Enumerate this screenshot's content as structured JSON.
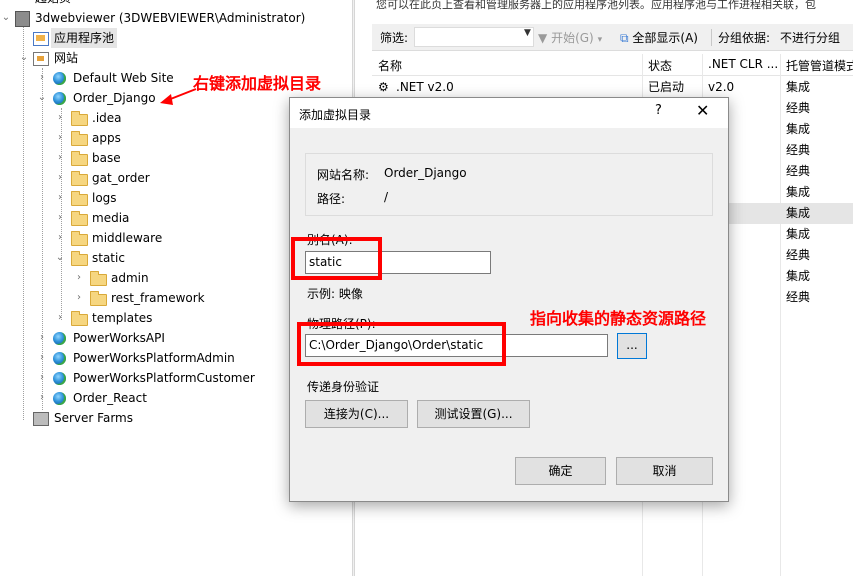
{
  "tree": {
    "top_partial": "起始页",
    "server": "3dwebviewer (3DWEBVIEWER\\Administrator)",
    "app_pools": "应用程序池",
    "sites": "网站",
    "default_site": "Default Web Site",
    "order_django": "Order_Django",
    "folders": [
      ".idea",
      "apps",
      "base",
      "gat_order",
      "logs",
      "media",
      "middleware",
      "static"
    ],
    "static_children": [
      "admin",
      "rest_framework"
    ],
    "templates": "templates",
    "other_sites": [
      "PowerWorksAPI",
      "PowerWorksPlatformAdmin",
      "PowerWorksPlatformCustomer",
      "Order_React"
    ],
    "server_farms": "Server Farms"
  },
  "right": {
    "description": "您可以在此页上查看和管理服务器上的应用程序池列表。应用程序池与工作进程相关联，包",
    "filter_label": "筛选:",
    "start_label": "开始(G)",
    "show_all_label": "全部显示(A)",
    "group_by_label": "分组依据:",
    "group_value": "不进行分组",
    "columns": [
      "名称",
      "状态",
      ".NET CLR ...",
      "托管管道模式"
    ],
    "pool_row": {
      "name": ".NET v2.0",
      "status": "已启动",
      "clr": "v2.0"
    },
    "pipeline_modes": [
      "集成",
      "经典",
      "集成",
      "经典",
      "经典",
      "集成",
      "集成",
      "集成",
      "经典",
      "集成",
      "经典"
    ]
  },
  "dialog": {
    "title": "添加虚拟目录",
    "help": "?",
    "close": "✕",
    "site_name_label": "网站名称:",
    "site_name": "Order_Django",
    "path_label": "路径:",
    "path": "/",
    "alias_label": "别名(A):",
    "alias_value": "static",
    "example": "示例: 映像",
    "physical_path_label": "物理路径(P):",
    "physical_path_value": "C:\\Order_Django\\Order\\static",
    "browse": "...",
    "pass_through_label": "传递身份验证",
    "connect_as": "连接为(C)...",
    "test_settings": "测试设置(G)...",
    "ok": "确定",
    "cancel": "取消"
  },
  "annotations": {
    "right_click": "右键添加虚拟目录",
    "point_to": "指向收集的静态资源路径"
  }
}
